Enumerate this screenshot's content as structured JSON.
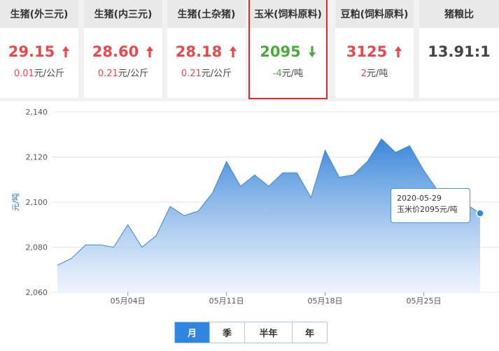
{
  "cards": [
    {
      "title": "生猪(外三元)",
      "price": "29.15",
      "change": "0.01",
      "unit": "元/公斤",
      "trend": "up"
    },
    {
      "title": "生猪(内三元)",
      "price": "28.60",
      "change": "0.21",
      "unit": "元/公斤",
      "trend": "up"
    },
    {
      "title": "生猪(土杂猪)",
      "price": "28.18",
      "change": "0.21",
      "unit": "元/公斤",
      "trend": "up"
    },
    {
      "title": "玉米(饲料原料)",
      "price": "2095",
      "change": "-4",
      "unit": "元/吨",
      "trend": "down"
    },
    {
      "title": "豆粕(饲料原料)",
      "price": "3125",
      "change": "2",
      "unit": "元/吨",
      "trend": "up"
    },
    {
      "title": "猪粮比",
      "price": "13.91:1",
      "change": "",
      "unit": "",
      "trend": "none"
    }
  ],
  "colors": {
    "up": "#e8484c",
    "down": "#4da83e",
    "accent": "#2f86e0",
    "highlight": "#e0262a"
  },
  "tooltip": {
    "date": "2020-05-29",
    "text": "玉米价2095元/吨"
  },
  "tabs": [
    {
      "label": "月",
      "active": true
    },
    {
      "label": "季",
      "active": false
    },
    {
      "label": "半年",
      "active": false
    },
    {
      "label": "年",
      "active": false
    }
  ],
  "chart_data": {
    "type": "area",
    "ylabel": "元/吨",
    "ylim": [
      2060,
      2140
    ],
    "yticks": [
      2060,
      2080,
      2100,
      2120,
      2140
    ],
    "ytick_labels": [
      "2,060",
      "2,080",
      "2,100",
      "2,120",
      "2,140"
    ],
    "xtick_labels": [
      "05月04日",
      "05月11日",
      "05月18日",
      "05月25日"
    ],
    "xtick_index": [
      5,
      12,
      19,
      26
    ],
    "grid": true,
    "x": [
      "2020-04-29",
      "2020-04-30",
      "2020-05-01",
      "2020-05-02",
      "2020-05-03",
      "2020-05-04",
      "2020-05-05",
      "2020-05-06",
      "2020-05-07",
      "2020-05-08",
      "2020-05-09",
      "2020-05-10",
      "2020-05-11",
      "2020-05-12",
      "2020-05-13",
      "2020-05-14",
      "2020-05-15",
      "2020-05-16",
      "2020-05-17",
      "2020-05-18",
      "2020-05-19",
      "2020-05-20",
      "2020-05-21",
      "2020-05-22",
      "2020-05-23",
      "2020-05-24",
      "2020-05-25",
      "2020-05-26",
      "2020-05-27",
      "2020-05-28",
      "2020-05-29"
    ],
    "values": [
      2072,
      2075,
      2081,
      2081,
      2080,
      2090,
      2080,
      2085,
      2098,
      2094,
      2096,
      2104,
      2118,
      2107,
      2112,
      2107,
      2113,
      2113,
      2102,
      2123,
      2111,
      2112,
      2118,
      2128,
      2122,
      2125,
      2114,
      2105,
      2106,
      2099,
      2095
    ]
  }
}
